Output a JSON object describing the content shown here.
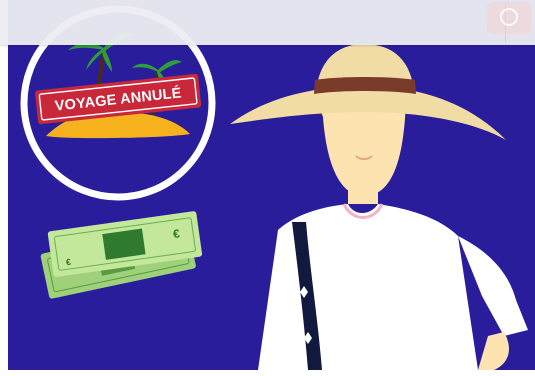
{
  "illustration": {
    "stamp_text": "VOYAGE ANNULÉ"
  },
  "colors": {
    "background": "#2a1d9c",
    "stamp": "#c8283a",
    "banknote": "#b7e08a",
    "hat": "#f2dca6",
    "hat_band": "#7a3b2a",
    "skin": "#fde3b0",
    "shirt": "#ffffff",
    "strap": "#111a3e"
  },
  "icons": {
    "top_right_control": "circle-outline-icon"
  }
}
